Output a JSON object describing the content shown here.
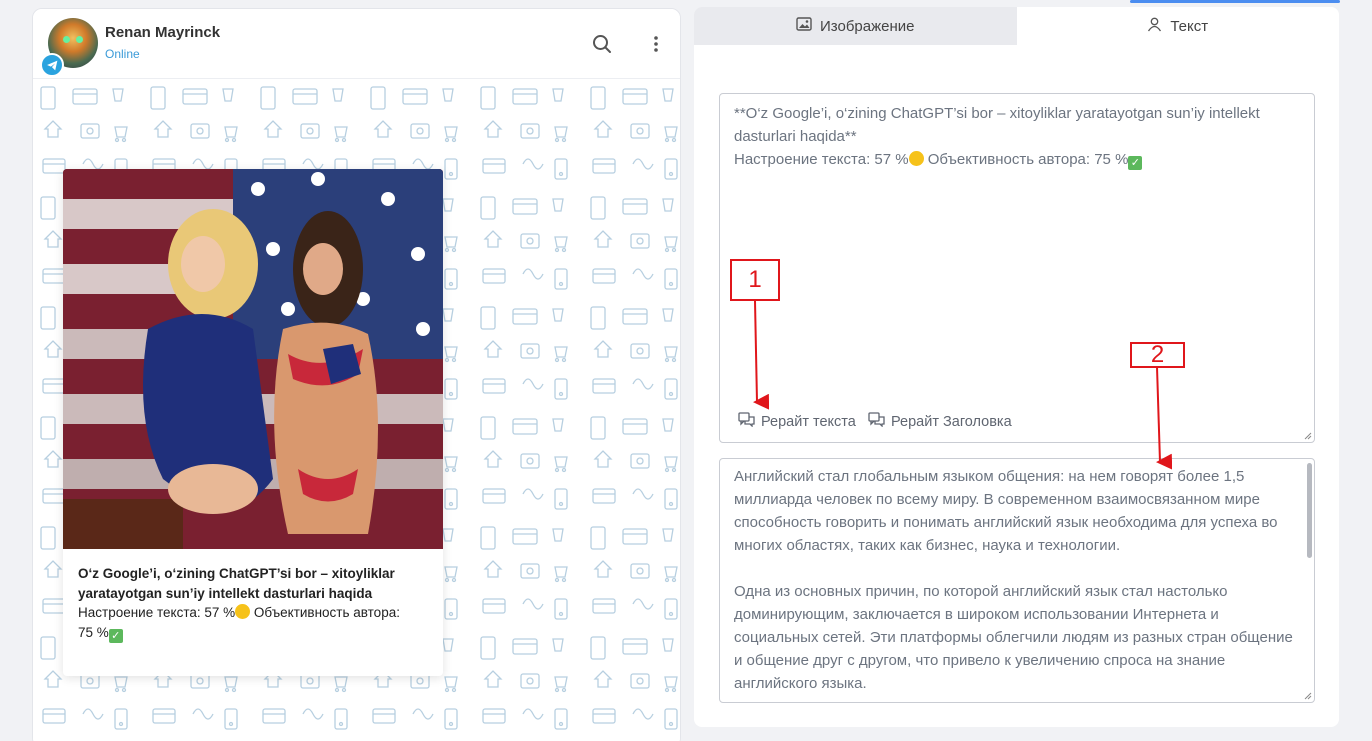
{
  "chat": {
    "contact_name": "Renan Mayrinck",
    "contact_status": "Online",
    "message": {
      "title": "O‘z Google’i, o‘zining ChatGPT’si bor – xitoyliklar yaratayotgan sun’iy intellekt dasturlari haqida",
      "mood_label": "Настроение текста: 57 %",
      "objectivity_label": "Объективность автора:",
      "objectivity_value": "75 %"
    }
  },
  "tabs": [
    {
      "label": "Изображение",
      "icon": "image-icon",
      "active": false
    },
    {
      "label": "Текст",
      "icon": "user-icon",
      "active": true
    }
  ],
  "editor": {
    "line1": "**O‘z Google’i, o‘zining ChatGPT’si bor – xitoyliklar yaratayotgan sun’iy intellekt dasturlari haqida**",
    "mood_label": "Настроение текста: 57 %",
    "objectivity_label": "Объективность автора: 75 %",
    "rewrite_text_label": "Рерайт текста",
    "rewrite_title_label": "Рерайт Заголовка"
  },
  "result": {
    "paragraphs": [
      "Английский стал глобальным языком общения: на нем говорят более 1,5 миллиарда человек по всему миру. В современном взаимосвязанном мире способность говорить и понимать английский язык необходима для успеха во многих областях, таких как бизнес, наука и технологии.",
      "Одна из основных причин, по которой английский язык стал настолько доминирующим, заключается в широком использовании Интернета и социальных сетей. Эти платформы облегчили людям из разных стран общение и общение друг с другом, что привело к увеличению спроса на знание английского языка."
    ]
  },
  "annotations": {
    "marker_1": "1",
    "marker_2": "2",
    "color": "#e0161b"
  },
  "colors": {
    "accent": "#3b9bd8",
    "telegram": "#2aa3df",
    "pattern": "#b7cfe0"
  }
}
